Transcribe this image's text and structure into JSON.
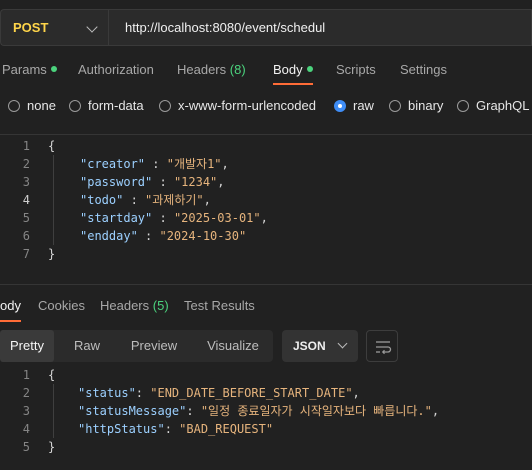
{
  "request": {
    "method": "POST",
    "url": "http://localhost:8080/event/schedul"
  },
  "request_tabs": [
    {
      "label": "Params"
    },
    {
      "label": "Authorization"
    },
    {
      "label": "Headers",
      "count": "(8)"
    },
    {
      "label": "Body"
    },
    {
      "label": "Scripts"
    },
    {
      "label": "Settings"
    }
  ],
  "body_types": [
    "none",
    "form-data",
    "x-www-form-urlencoded",
    "raw",
    "binary",
    "GraphQL"
  ],
  "selected_body_type": "raw",
  "request_body": {
    "line_numbers": [
      "1",
      "2",
      "3",
      "4",
      "5",
      "6",
      "7"
    ],
    "open_brace": "{",
    "close_brace": "}",
    "fields": [
      {
        "key": "\"creator\"",
        "sep": " : ",
        "value": "\"개발자1\"",
        "end": ","
      },
      {
        "key": "\"password\"",
        "sep": " : ",
        "value": "\"1234\"",
        "end": ","
      },
      {
        "key": "\"todo\"",
        "sep": " : ",
        "value": "\"과제하기\"",
        "end": ","
      },
      {
        "key": "\"startday\"",
        "sep": " : ",
        "value": "\"2025-03-01\"",
        "end": ","
      },
      {
        "key": "\"endday\"",
        "sep": " : ",
        "value": "\"2024-10-30\"",
        "end": ""
      }
    ]
  },
  "response_tabs": [
    {
      "label": "ody"
    },
    {
      "label": "Cookies"
    },
    {
      "label": "Headers",
      "count": "(5)"
    },
    {
      "label": "Test Results"
    }
  ],
  "view_modes": [
    "Pretty",
    "Raw",
    "Preview",
    "Visualize"
  ],
  "format": "JSON",
  "response_body": {
    "line_numbers": [
      "1",
      "2",
      "3",
      "4",
      "5"
    ],
    "open_brace": "{",
    "close_brace": "}",
    "fields": [
      {
        "key": "\"status\"",
        "sep": ": ",
        "value": "\"END_DATE_BEFORE_START_DATE\"",
        "end": ","
      },
      {
        "key": "\"statusMessage\"",
        "sep": ": ",
        "value": "\"일정 종료일자가 시작일자보다 빠릅니다.\"",
        "end": ","
      },
      {
        "key": "\"httpStatus\"",
        "sep": ": ",
        "value": "\"BAD_REQUEST\"",
        "end": ""
      }
    ]
  },
  "colors": {
    "accent": "#ff6c37",
    "method": "#ffd54a",
    "indicator": "#4bd37d",
    "radio_selected": "#3f8df6"
  }
}
